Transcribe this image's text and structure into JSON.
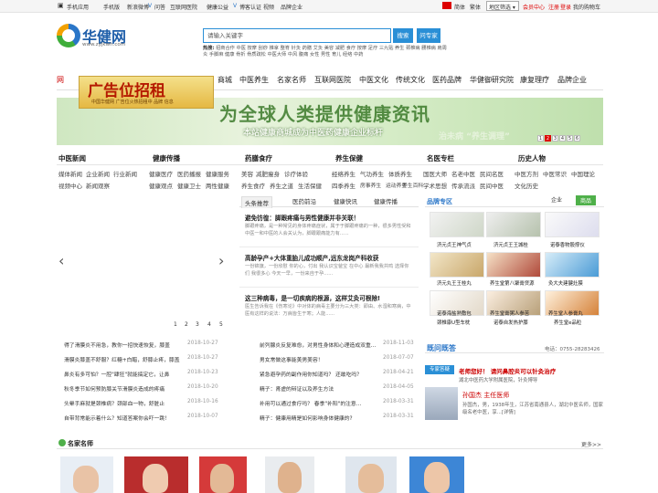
{
  "topbar": {
    "left": [
      "手机应用",
      "手机版",
      "新浪微博",
      "问答",
      "互联网医院",
      "健康公益",
      "博客认证",
      "视频",
      "品牌企业"
    ],
    "lang": [
      "简体",
      "繁体"
    ],
    "region_select": "地区筛选",
    "center": "会员中心",
    "register": "注册",
    "login": "登录",
    "cart": "我的购物车"
  },
  "brand": {
    "name": "华健网",
    "url": "www.zyjkwh.com"
  },
  "search": {
    "placeholder": "请输入关键字",
    "button": "搜索",
    "ask_button": "问专家",
    "hot_label": "热搜:",
    "hot_terms": "招商合作 中医 按摩 刮痧 推拿 整脊 针灸 药膳 艾灸 美容 减肥 食疗 按摩 足疗 三九贴 养生 颈椎病 腰椎病 肩周炎 手脚麻 健康 骨折 骨质疏松 中医大师 中风 腹痛 女性 男性 育儿 经络 中药"
  },
  "nav": {
    "items": [
      "商城",
      "中医养生",
      "名家名师",
      "互联网医院",
      "中医文化",
      "传统文化",
      "医药品牌",
      "华健御研究院",
      "康复理疗",
      "品牌企业"
    ]
  },
  "ad": {
    "title": "广告位招租",
    "sub": "中国华健网 广告位火热招租中 品牌 信息"
  },
  "banner": {
    "title": "为全球人类提供健康资讯",
    "sub": "本站健康商城成为中医药健康企业标杆",
    "sub2": "治未病 “养生调理”",
    "pages": [
      "1",
      "2",
      "3",
      "4",
      "5",
      "6"
    ],
    "active_page": "2"
  },
  "categories": [
    {
      "title": "中医新闻",
      "links": [
        [
          "媒体新闻",
          "企业新闻",
          "行业新闻"
        ],
        [
          "视频中心",
          "新闻观察"
        ]
      ]
    },
    {
      "title": "健康传播",
      "links": [
        [
          "健康医疗",
          "医药播报",
          "健康服务"
        ],
        [
          "健康观点",
          "健康卫士",
          "两性健康"
        ]
      ]
    },
    {
      "title": "药膳食疗",
      "links": [
        [
          "美容",
          "减肥瘦身",
          "诊疗体验"
        ],
        [
          "养生食疗",
          "养生之道",
          "生活保健"
        ]
      ]
    },
    {
      "title": "养生保健",
      "links": [
        [
          "经络养生",
          "气功养生",
          "体质养生"
        ],
        [
          "四季养生",
          "房事养生",
          "运动养生",
          "养生百科"
        ]
      ]
    },
    {
      "title": "名医专栏",
      "links": [
        [
          "国医大师",
          "名老中医",
          "民间名医"
        ],
        [
          "学术思想",
          "传承流派",
          "民间中医"
        ]
      ]
    },
    {
      "title": "历史人物",
      "links": [
        [
          "中医方剂",
          "中医常识",
          "中国理论"
        ],
        [
          "文化历史"
        ]
      ]
    }
  ],
  "slider": {
    "dots": [
      "1",
      "2",
      "3",
      "4",
      "5"
    ]
  },
  "articles": {
    "tabs": [
      "头条推荐",
      "医药前沿",
      "健康快讯",
      "健康传播"
    ],
    "items": [
      {
        "title": "避免彷徨：脚跟疼痛与男性健康并非关联！",
        "desc": "脚跟疼痛，是一种常见的身体疼痛症状，属于于脚跟疼痛的一种，很多男性受和中医一和中医的人会关认为，脚跟跟痛能力有......"
      },
      {
        "title": "高龄孕产+大体重胎儿成功顺产,远东龙岗产科收获",
        "desc": "一份锦旗，一份欣慰 你的心，付出 我认识宝爸宝 在中心 最新我我共鸣 选择你们 我很多心 今天一早，一份来自于孕......"
      },
      {
        "title": "这三种病毒，是一切疾病的根源，这样艾灸可根除!",
        "desc": "医生告诉我在《伤寒论》中对体的病毒主要分为三大类：即由、水湿和寒病，中医有这样的说法：万病皆生于寒；人能......"
      }
    ]
  },
  "news_left": [
    {
      "title": "得了滑膜炎不用急，教你一招快速恢复，膝盖",
      "date": "2018-10-27"
    },
    {
      "title": "滑膜炎膝盖不舒服？红糖+白醋，舒膝止疼，膝盖",
      "date": "2018-10-27"
    },
    {
      "title": "鼻炎有多可怕？一腔\"肆狂\"就能搞定它，让鼻",
      "date": "2018-10-23"
    },
    {
      "title": "秋冬季节如何预防膝关节滑膜炎造成的疼痛",
      "date": "2018-10-20"
    },
    {
      "title": "头晕手麻就是颈椎病？颈部血一物，舒脏止",
      "date": "2018-10-16"
    },
    {
      "title": "自带背常能示着什么？知道答案你会吓一跳！",
      "date": "2018-10-07"
    }
  ],
  "news_right": [
    {
      "title": "前列腺炎反复难愈，对男性身体和心理造成双重...",
      "date": "2018-11-03"
    },
    {
      "title": "男女常做这事能美男美容！",
      "date": "2018-07-07"
    },
    {
      "title": "紧急避孕药的副作用你知道吗？ 还敢吃吗？",
      "date": "2018-04-21"
    },
    {
      "title": "精子：肾虚的辩证以及养生方法",
      "date": "2018-04-05"
    },
    {
      "title": "补用可以通过食疗吗？ 春季\"补阳\"的注意...",
      "date": "2018-03-31"
    },
    {
      "title": "精子：健康用精是如何影响身体健康的?",
      "date": "2018-03-31"
    }
  ],
  "products": {
    "title": "品牌专区",
    "tabs": [
      "企业",
      "商品"
    ],
    "items": [
      "济元贞王神气贞",
      "济元贞王王城桂",
      "诺泰香物股撑仪",
      "济元丸王王桂丸",
      "养生堂第八聚膏贷源",
      "灸大夫建腱灶膜",
      "诺泰海盐熟敷包",
      "养生堂膏粥人参苦",
      "养生堂人参膏丸",
      "颈椎康U型车枕",
      "诺泰自发热护膝",
      "养生堂e品粒"
    ]
  },
  "qa": {
    "title": "既问既答",
    "phone": "电话：0755-28283426",
    "tag": "专家答疑",
    "question": "老师您好！ 请问鼻腔炎可以针灸治疗",
    "sub": "湖北中医药大学附属医院，针灸博导",
    "doctor_name": "孙国杰 主任医师",
    "doctor_desc": "孙国杰，男，1938年生，江苏省南通县人，湖北中医名师，国家级名老中医，享...[详情]"
  },
  "famous": {
    "title": "名家名师",
    "more": "更多>>"
  },
  "colors": {
    "brand_blue": "#2a8fd6",
    "accent_red": "#dd0000",
    "green": "#4fb04a"
  }
}
